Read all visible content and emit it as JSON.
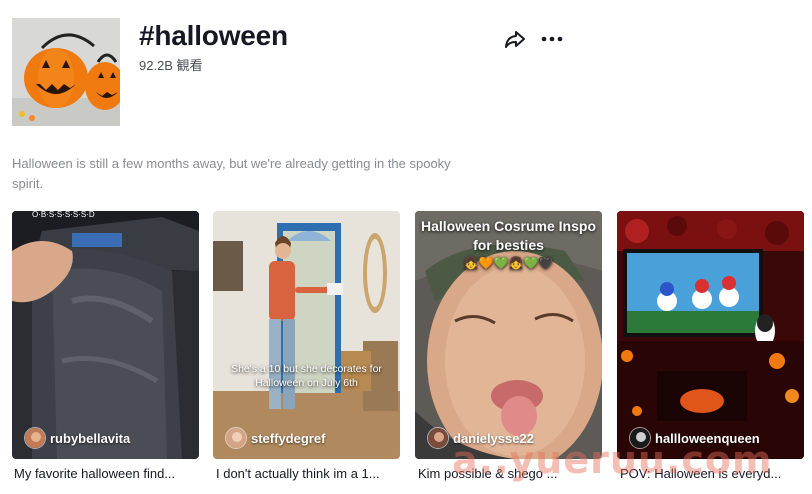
{
  "header": {
    "title": "#halloween",
    "views": "92.2B 観看",
    "cover_icon": "jack-o-lantern-image"
  },
  "actions": {
    "share_icon": "share-arrow-icon",
    "more_icon": "more-horizontal-icon"
  },
  "description": "Halloween is still a few months away, but we're already getting in the spooky spirit.",
  "videos": [
    {
      "username": "rubybellavita",
      "caption": "My favorite halloween find...",
      "overlay_text": ""
    },
    {
      "username": "steffydegref",
      "caption": "I don't actually think im a 1...",
      "overlay_text": "She's a 10 but she decorates for Halloween on July 6th"
    },
    {
      "username": "danielysse22",
      "caption": "Kim possible & shego ...",
      "overlay_title": "Halloween Cosrume Inspo for besties",
      "overlay_emoji": "👧🧡💚👧💚🖤"
    },
    {
      "username": "hallloweenqueen",
      "caption": "POV: Halloween is everyd...",
      "overlay_text": ""
    }
  ],
  "watermark": "a..yueruu.com",
  "colors": {
    "text": "#161823",
    "muted": "#8a8b91",
    "white": "#ffffff"
  }
}
